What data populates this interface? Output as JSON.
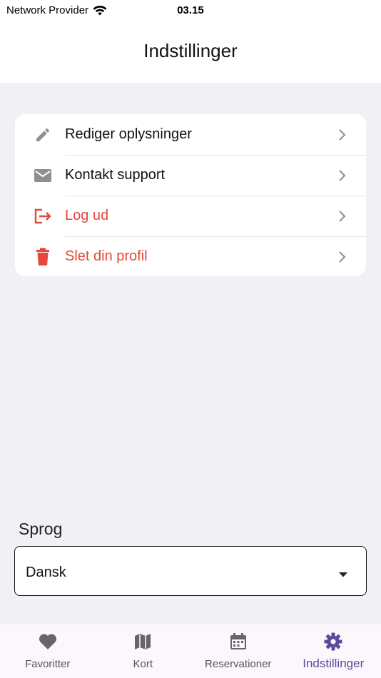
{
  "status_bar": {
    "carrier": "Network Provider",
    "time": "03.15"
  },
  "header": {
    "title": "Indstillinger"
  },
  "menu": {
    "items": [
      {
        "label": "Rediger oplysninger",
        "icon": "pencil-icon",
        "danger": false
      },
      {
        "label": "Kontakt support",
        "icon": "envelope-icon",
        "danger": false
      },
      {
        "label": "Log ud",
        "icon": "logout-icon",
        "danger": true
      },
      {
        "label": "Slet din profil",
        "icon": "trash-icon",
        "danger": true
      }
    ]
  },
  "language": {
    "label": "Sprog",
    "selected": "Dansk"
  },
  "tabbar": {
    "tabs": [
      {
        "label": "Favoritter",
        "icon": "heart-icon",
        "active": false
      },
      {
        "label": "Kort",
        "icon": "map-icon",
        "active": false
      },
      {
        "label": "Reservationer",
        "icon": "calendar-icon",
        "active": false
      },
      {
        "label": "Indstillinger",
        "icon": "gear-icon",
        "active": true
      }
    ]
  },
  "colors": {
    "danger": "#e5473b",
    "accent": "#5b4a9a",
    "icon_gray": "#8e8e93",
    "background": "#f1f0f5"
  }
}
